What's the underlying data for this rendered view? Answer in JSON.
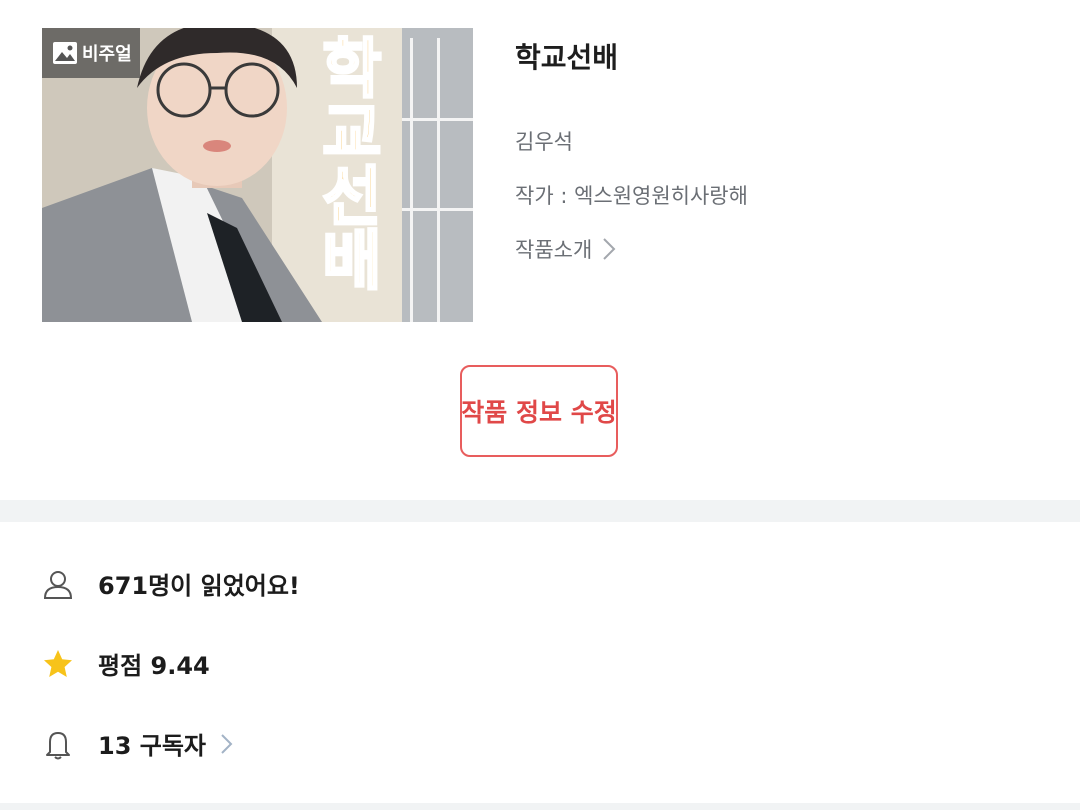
{
  "work": {
    "badge_label": "비주얼",
    "cover_text": "학교선배",
    "title": "학교선배",
    "character": "김우석",
    "author": "작가 : 엑스원영원히사랑해",
    "intro_label": "작품소개"
  },
  "actions": {
    "edit_label": "작품 정보 수정"
  },
  "stats": {
    "readers_text": "671명이 읽었어요!",
    "rating_text": "평점 9.44",
    "subscribers_text": "13 구독자"
  },
  "colors": {
    "accent_red": "#e85d5d",
    "star_yellow": "#f7c31a",
    "muted_text": "#6b6f75",
    "divider": "#f1f3f4"
  },
  "icons": {
    "badge": "image-icon",
    "intro_more": "chevron-right-icon",
    "readers": "person-icon",
    "rating": "star-icon",
    "subscribers": "bell-icon",
    "subscribers_more": "chevron-right-icon"
  }
}
